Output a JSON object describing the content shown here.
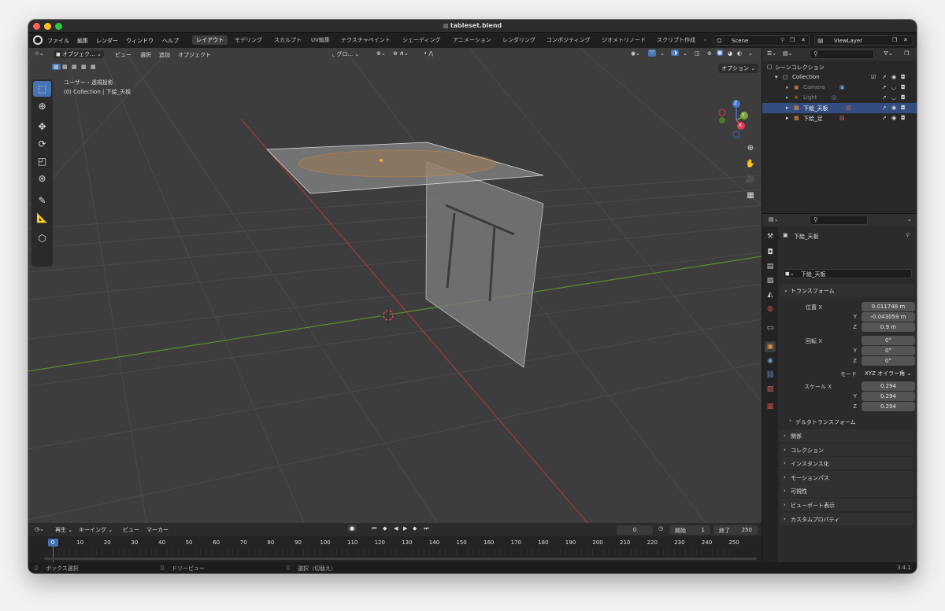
{
  "window": {
    "title": "tableset.blend"
  },
  "menu": {
    "app_icon": "blender-logo-icon",
    "items": [
      "ファイル",
      "編集",
      "レンダー",
      "ウィンドウ",
      "ヘルプ"
    ]
  },
  "workspaces": {
    "tabs": [
      "レイアウト",
      "モデリング",
      "スカルプト",
      "UV編集",
      "テクスチャペイント",
      "シェーディング",
      "アニメーション",
      "レンダリング",
      "コンポジティング",
      "ジオメトリノード",
      "スクリプト作成"
    ],
    "active_index": 0
  },
  "scene": {
    "name": "Scene",
    "view_layer": "ViewLayer"
  },
  "viewport": {
    "header": {
      "mode": "オブジェク...",
      "view": "ビュー",
      "select": "選択",
      "add": "追加",
      "object": "オブジェクト",
      "transform_orient": "グロ...",
      "options": "オプション"
    },
    "overlay_text": {
      "view_name": "ユーザー・透視投影",
      "collection_info": "(0) Collection | 下絵_天板"
    },
    "gizmo": {
      "x": "X",
      "y": "Y",
      "z": "Z"
    },
    "accent": "#4772b3"
  },
  "toolbar": {
    "tools": [
      "select-box-icon",
      "cursor-icon",
      "move-icon",
      "rotate-icon",
      "scale-icon",
      "transform-icon",
      "annotate-icon",
      "measure-icon",
      "add-cube-icon"
    ]
  },
  "outliner": {
    "root": "シーンコレクション",
    "items": [
      {
        "name": "Collection",
        "indent": 1,
        "selected": false
      },
      {
        "name": "Camera",
        "indent": 2,
        "selected": false
      },
      {
        "name": "Light",
        "indent": 2,
        "selected": false
      },
      {
        "name": "下絵_天板",
        "indent": 2,
        "selected": true
      },
      {
        "name": "下絵_足",
        "indent": 2,
        "selected": false
      }
    ]
  },
  "properties": {
    "object_name": "下絵_天板",
    "data_name": "下絵_天板",
    "transform_label": "トランスフォーム",
    "location_label": "位置",
    "rotation_label": "回転",
    "mode_label": "モード",
    "scale_label": "スケール",
    "axes": [
      "X",
      "Y",
      "Z"
    ],
    "location": [
      "0.011748 m",
      "-0.043059 m",
      "0.9 m"
    ],
    "rotation": [
      "0°",
      "0°",
      "0°"
    ],
    "mode": "XYZ オイラー角",
    "scale": [
      "0.294",
      "0.294",
      "0.294"
    ],
    "delta": "デルタトランスフォーム",
    "panels": [
      "関係",
      "コレクション",
      "インスタンス化",
      "モーションパス",
      "可視性",
      "ビューポート表示",
      "カスタムプロパティ"
    ]
  },
  "timeline": {
    "playback": "再生",
    "keying": "キーイング",
    "view": "ビュー",
    "marker": "マーカー",
    "current": "0",
    "start_label": "開始",
    "start": "1",
    "end_label": "終了",
    "end": "250",
    "ticks": [
      "0",
      "10",
      "20",
      "30",
      "40",
      "50",
      "60",
      "70",
      "80",
      "90",
      "100",
      "110",
      "120",
      "130",
      "140",
      "150",
      "160",
      "170",
      "180",
      "190",
      "200",
      "210",
      "220",
      "230",
      "240",
      "250"
    ]
  },
  "status": {
    "left": "ボックス選択",
    "middle": "ドリービュー",
    "right": "選択（切替え）",
    "version": "3.4.1"
  }
}
